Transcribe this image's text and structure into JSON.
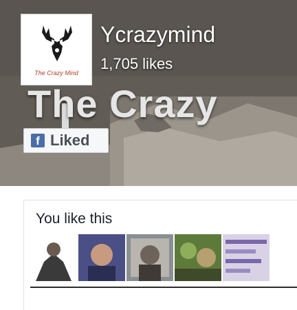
{
  "page": {
    "name": "Ycrazymind",
    "likes": "1,705 likes",
    "logo_text": "The Crazy Mind",
    "cover_slogan": "The Crazy"
  },
  "actions": {
    "liked_label": "Liked",
    "fb_icon_glyph": "f"
  },
  "friends": {
    "title": "You like this",
    "avatars": [
      "friend-1",
      "friend-2",
      "friend-3",
      "friend-4",
      "friend-5"
    ]
  },
  "colors": {
    "facebook_blue": "#4a6ea8",
    "button_bg": "#f6f7f9",
    "text_dark": "#1d2129"
  }
}
